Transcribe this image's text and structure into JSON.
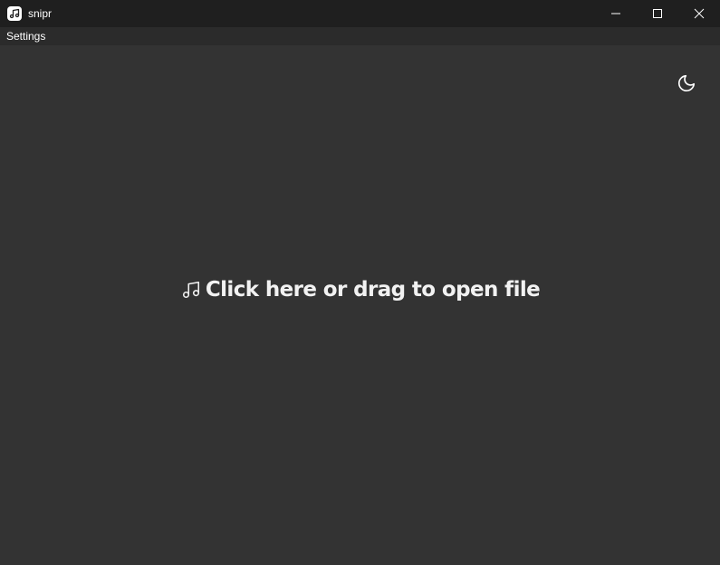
{
  "window": {
    "title": "snipr",
    "app_icon": "music-note-icon",
    "controls": [
      "minimize-icon",
      "maximize-icon",
      "close-icon"
    ]
  },
  "menu": {
    "items": [
      {
        "label": "Settings"
      }
    ]
  },
  "main": {
    "theme_toggle_icon": "moon-icon",
    "drop_zone": {
      "icon": "music-note-icon",
      "label": "Click here or drag to open file"
    }
  },
  "colors": {
    "titlebar_bg": "#1f1f1f",
    "menubar_bg": "#2b2b2b",
    "content_bg": "#333333",
    "text": "#ffffff"
  }
}
